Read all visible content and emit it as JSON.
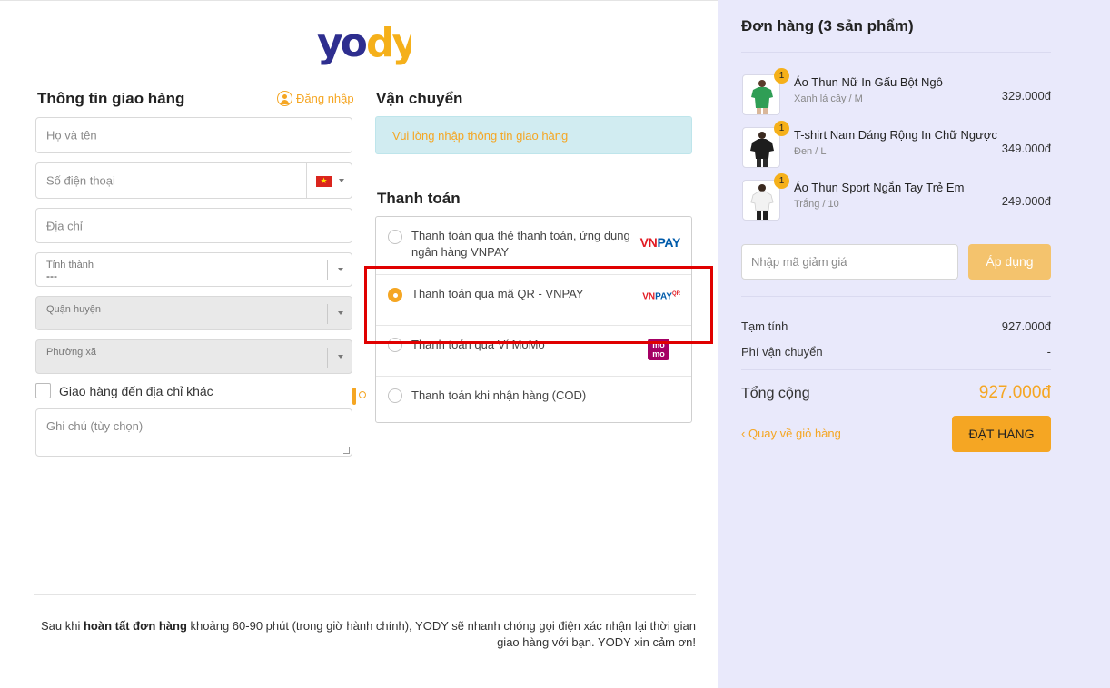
{
  "logo": {
    "text": "yody",
    "colors": {
      "primary": "#2e2e8f",
      "accent": "#f5b01a"
    }
  },
  "shipping_info": {
    "title": "Thông tin giao hàng",
    "login_label": "Đăng nhập",
    "login_icon": "user-circle-icon",
    "fields": {
      "full_name": "Họ và tên",
      "phone": "Số điện thoại",
      "phone_country": "flag-vn-icon",
      "address": "Địa chỉ",
      "province_label": "Tỉnh thành",
      "province_value": "---",
      "district": "Quận huyện",
      "ward": "Phường xã"
    },
    "other_address_label": "Giao hàng đến địa chỉ khác",
    "note_placeholder": "Ghi chú (tùy chọn)"
  },
  "delivery": {
    "title": "Vận chuyển",
    "message": "Vui lòng nhập thông tin giao hàng"
  },
  "payment": {
    "title": "Thanh toán",
    "options": [
      {
        "label": "Thanh toán qua thẻ thanh toán, ứng dụng ngân hàng VNPAY",
        "logo": "vnpay-icon",
        "selected": false
      },
      {
        "label": "Thanh toán qua mã QR - VNPAY",
        "logo": "vnpay-qr-icon",
        "selected": true
      },
      {
        "label": "Thanh toán qua Ví MoMo",
        "logo": "momo-icon",
        "selected": false
      },
      {
        "label": "Thanh toán khi nhận hàng (COD)",
        "logo": "cash-icon",
        "selected": false
      }
    ],
    "logo_text": {
      "vn": "VN",
      "pay": "PAY",
      "qr": "QR",
      "momo_top": "mo",
      "momo_bottom": "mo"
    }
  },
  "footer": {
    "prefix": "Sau khi ",
    "bold": "hoàn tất đơn hàng",
    "suffix": " khoảng 60-90 phút (trong giờ hành chính), YODY sẽ nhanh chóng gọi điện xác nhận lại thời gian giao hàng với bạn. YODY xin cảm ơn!"
  },
  "order": {
    "title": "Đơn hàng (3 sản phẩm)",
    "items": [
      {
        "name": "Áo Thun Nữ In Gấu Bột Ngô",
        "variant": "Xanh lá cây / M",
        "price": "329.000đ",
        "qty": "1",
        "shirt_color": "#2f9e55"
      },
      {
        "name": "T-shirt Nam Dáng Rộng In Chữ Ngược",
        "variant": "Đen / L",
        "price": "349.000đ",
        "qty": "1",
        "shirt_color": "#1d1d1d"
      },
      {
        "name": "Áo Thun Sport Ngắn Tay Trẻ Em",
        "variant": "Trắng / 10",
        "price": "249.000đ",
        "qty": "1",
        "shirt_color": "#f2f2f2"
      }
    ],
    "coupon_placeholder": "Nhập mã giảm giá",
    "apply_label": "Áp dụng",
    "subtotal_label": "Tạm tính",
    "subtotal_value": "927.000đ",
    "shipping_label": "Phí vận chuyển",
    "shipping_value": "-",
    "total_label": "Tổng cộng",
    "total_value": "927.000đ",
    "back_label": "Quay về giỏ hàng",
    "back_icon": "chevron-left-icon",
    "order_button": "ĐẶT HÀNG"
  },
  "highlight_color": "#e00000"
}
